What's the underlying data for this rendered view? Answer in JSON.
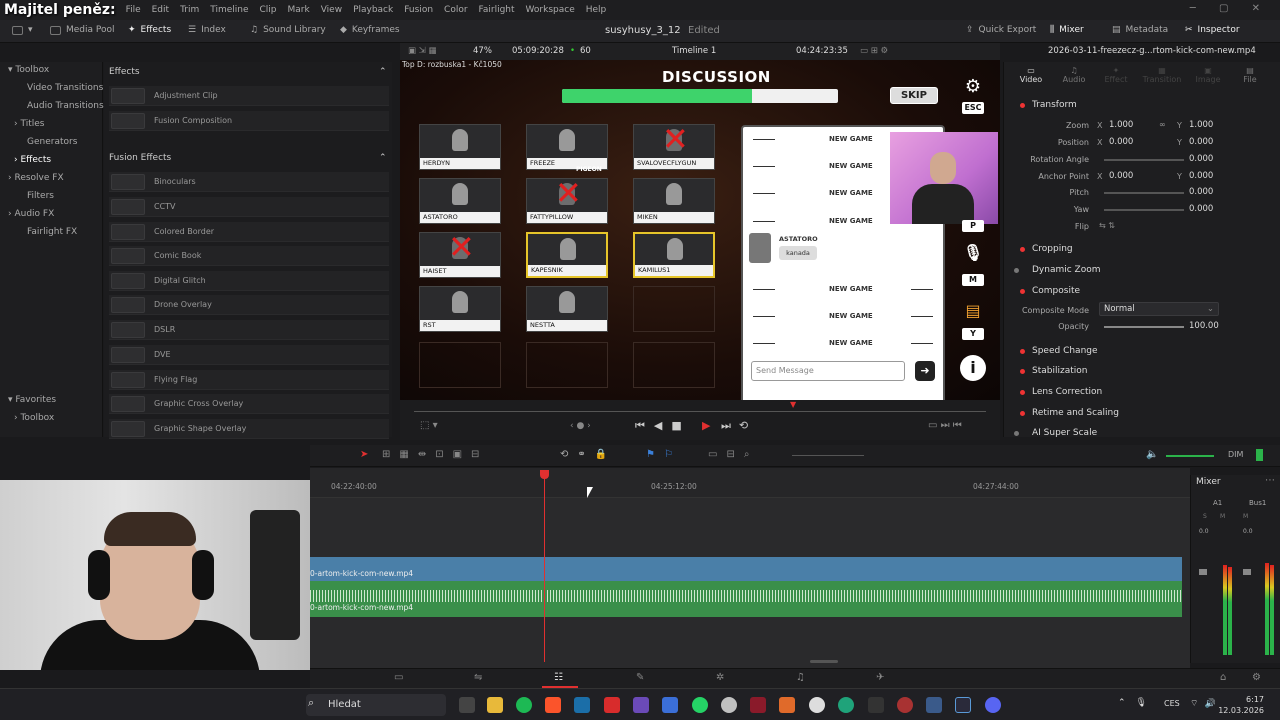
{
  "menubar": {
    "owner_label": "Majitel peněz:",
    "items": [
      "File",
      "Edit",
      "Trim",
      "Timeline",
      "Clip",
      "Mark",
      "View",
      "Playback",
      "Fusion",
      "Color",
      "Fairlight",
      "Workspace",
      "Help"
    ]
  },
  "toolbar": {
    "media_pool": "Media Pool",
    "effects": "Effects",
    "index": "Index",
    "sound_library": "Sound Library",
    "keyframes": "Keyframes",
    "project_name": "susyhusy_3_12",
    "project_status": "Edited",
    "quick_export": "Quick Export",
    "mixer": "Mixer",
    "metadata": "Metadata",
    "inspector": "Inspector"
  },
  "toolbox": {
    "header": "Toolbox",
    "items": [
      "Video Transitions",
      "Audio Transitions",
      "Titles",
      "Generators",
      "Effects",
      "Resolve FX",
      "Filters",
      "Audio FX",
      "Fairlight FX"
    ],
    "favorites": "Favorites",
    "fav_toolbox": "Toolbox"
  },
  "effects": {
    "header": "Effects",
    "top_items": [
      "Adjustment Clip",
      "Fusion Composition"
    ],
    "fusion_header": "Fusion Effects",
    "fusion_items": [
      "Binoculars",
      "CCTV",
      "Colored Border",
      "Comic Book",
      "Digital Glitch",
      "Drone Overlay",
      "DSLR",
      "DVE",
      "Flying Flag",
      "Graphic Cross Overlay",
      "Graphic Shape Overlay"
    ]
  },
  "viewer": {
    "zoom": "47%",
    "source_tc": "05:09:20:28",
    "fps": "60",
    "timeline_name": "Timeline 1",
    "record_tc": "04:24:23:35",
    "clip_name": "2026-03-11-freezecz-g...rtom-kick-com-new.mp4"
  },
  "game": {
    "top_info": "Top D: rozbuska1 - Kč1050",
    "title": "DISCUSSION",
    "progress": 0.69,
    "skip": "SKIP",
    "esc": "ESC",
    "players": [
      {
        "name": "HERDYN",
        "state": "alive",
        "hl": false
      },
      {
        "name": "FREEZE",
        "state": "alive",
        "hl": false
      },
      {
        "name": "SVALOVECFLYGUN",
        "state": "dead",
        "hl": false
      },
      {
        "name": "ASTATORO",
        "state": "alive",
        "hl": false
      },
      {
        "name": "FATTYPILLOW",
        "state": "dead",
        "hl": false
      },
      {
        "name": "MIKEN",
        "state": "alive",
        "hl": false
      },
      {
        "name": "HAISET",
        "state": "dead",
        "hl": false
      },
      {
        "name": "KAPESNIK",
        "state": "alive",
        "hl": true
      },
      {
        "name": "KAMILUS1",
        "state": "alive",
        "hl": true
      },
      {
        "name": "RST",
        "state": "alive",
        "hl": false
      },
      {
        "name": "NESTTA",
        "state": "alive",
        "hl": false
      }
    ],
    "pigeon": "PIGEON",
    "chat_rows": [
      "NEW GAME",
      "NEW GAME",
      "NEW GAME",
      "NEW GAME",
      "NEW GAME",
      "NEW GAME",
      "NEW GAME"
    ],
    "chat_msg_name": "ASTATORO",
    "chat_msg_text": "kanada",
    "send_placeholder": "Send Message",
    "keys": [
      "P",
      "M",
      "Y"
    ]
  },
  "inspector": {
    "tabs": [
      "Video",
      "Audio",
      "Effect",
      "Transition",
      "Image",
      "File"
    ],
    "sections": [
      "Transform",
      "Cropping",
      "Dynamic Zoom",
      "Composite",
      "Speed Change",
      "Stabilization",
      "Lens Correction",
      "Retime and Scaling",
      "AI Super Scale"
    ],
    "zoom_label": "Zoom",
    "zoom_x": "1.000",
    "zoom_y": "1.000",
    "position_label": "Position",
    "position_x": "0.000",
    "position_y": "0.000",
    "rotation_label": "Rotation Angle",
    "rotation": "0.000",
    "anchor_label": "Anchor Point",
    "anchor_x": "0.000",
    "anchor_y": "0.000",
    "pitch_label": "Pitch",
    "pitch": "0.000",
    "yaw_label": "Yaw",
    "yaw": "0.000",
    "flip_label": "Flip",
    "composite_mode_label": "Composite Mode",
    "composite_mode": "Normal",
    "opacity_label": "Opacity",
    "opacity": "100.00"
  },
  "timeline": {
    "tc_left": "04:22:40:00",
    "tc_mid": "04:25:12:00",
    "tc_right": "04:27:44:00",
    "video_clip": "0-artom-kick-com-new.mp4",
    "audio_clip": "0-artom-kick-com-new.mp4",
    "dim": "DIM"
  },
  "mixer": {
    "title": "Mixer",
    "ch1": "A1",
    "ch2": "Bus1",
    "s": "S",
    "m": "M",
    "val1": "0.0",
    "val2": "0.0"
  },
  "taskbar": {
    "search": "Hledat",
    "lang": "CES",
    "time": "6:17",
    "date": "12.03.2026"
  }
}
